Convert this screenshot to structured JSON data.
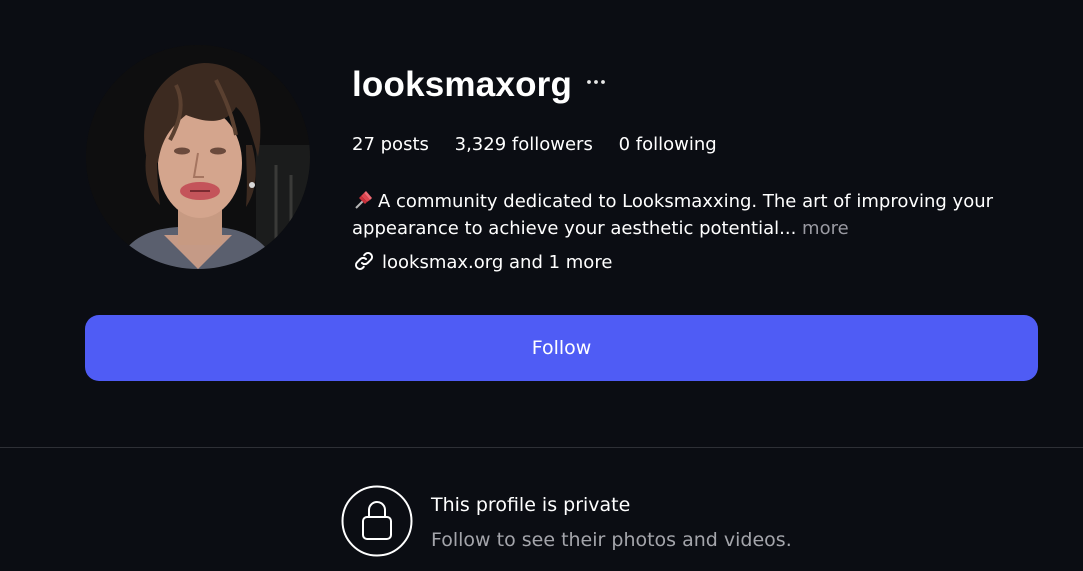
{
  "profile": {
    "username": "looksmaxorg",
    "avatar_alt": "profile photo"
  },
  "stats": {
    "posts": "27 posts",
    "followers": "3,329 followers",
    "following": "0 following"
  },
  "bio": {
    "icon": "pushpin-icon",
    "text": "A community dedicated to Looksmaxxing. The art of improving your appearance to achieve your aesthetic potential...",
    "more_label": "more"
  },
  "links": {
    "icon": "link-icon",
    "text": "looksmax.org and 1 more"
  },
  "actions": {
    "follow_label": "Follow",
    "more_options_icon": "ellipsis-icon"
  },
  "private_notice": {
    "icon": "lock-icon",
    "title": "This profile is private",
    "subtitle": "Follow to see their photos and videos."
  },
  "colors": {
    "background": "#0b0d13",
    "accent": "#4f5cf5",
    "muted_text": "#a4a5ab",
    "divider": "#2e3036"
  }
}
